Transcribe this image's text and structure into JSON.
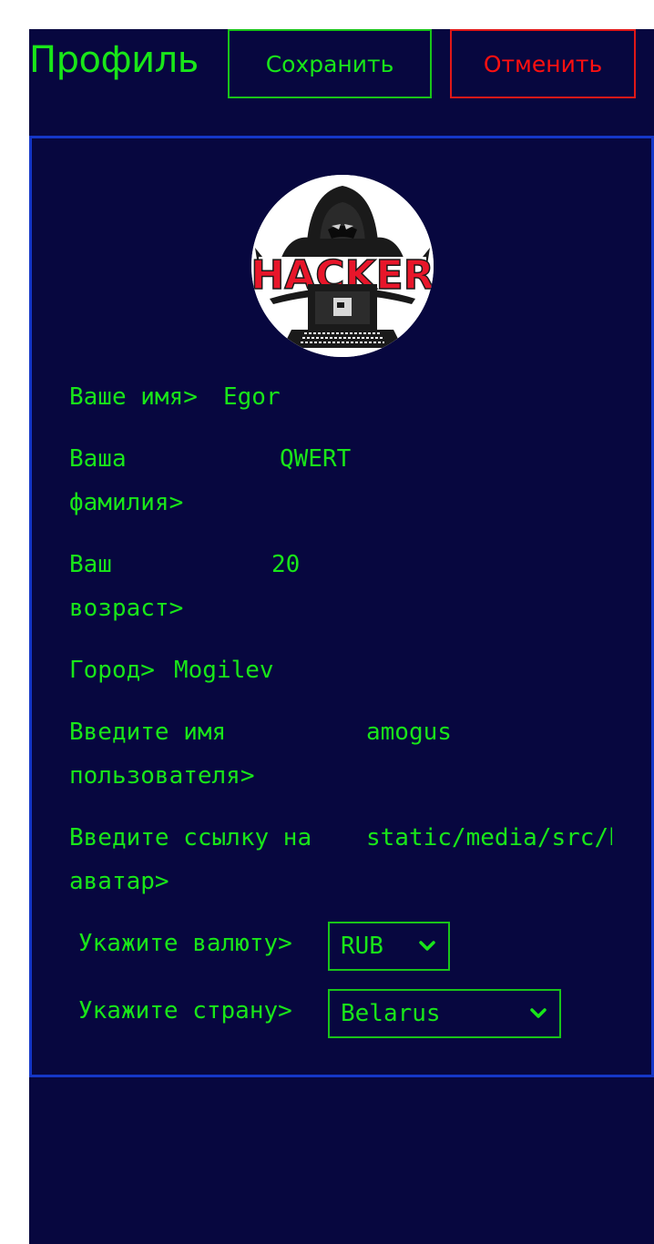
{
  "header": {
    "title": "Профиль",
    "save_label": "Сохранить",
    "cancel_label": "Отменить"
  },
  "avatar": {
    "alt": "HACKER",
    "logo_text": "HACKER"
  },
  "form": {
    "name": {
      "label_line1": "Ваше имя>",
      "value": "Egor"
    },
    "surname": {
      "label_line1": "Ваша",
      "label_line2": "фамилия>",
      "value": "QWERT"
    },
    "age": {
      "label_line1": "Ваш",
      "label_line2": "возраст>",
      "value": "20"
    },
    "city": {
      "label_line1": "Город>",
      "value": "Mogilev"
    },
    "username": {
      "label_line1": "Введите имя",
      "label_line2": "пользователя>",
      "value": "amogus"
    },
    "avatar_link": {
      "label_line1": "Введите ссылку на",
      "label_line2": "аватар>",
      "value": "static/media/src/hacker.png"
    },
    "currency": {
      "label": "Укажите валюту>",
      "selected": "RUB",
      "options": [
        "RUB"
      ]
    },
    "country": {
      "label": "Укажите страну>",
      "selected": "Belarus",
      "options": [
        "Belarus"
      ]
    }
  },
  "colors": {
    "background": "#07073f",
    "accent_green": "#19e619",
    "cancel_red": "#ff1010",
    "card_border": "#1537c7"
  }
}
